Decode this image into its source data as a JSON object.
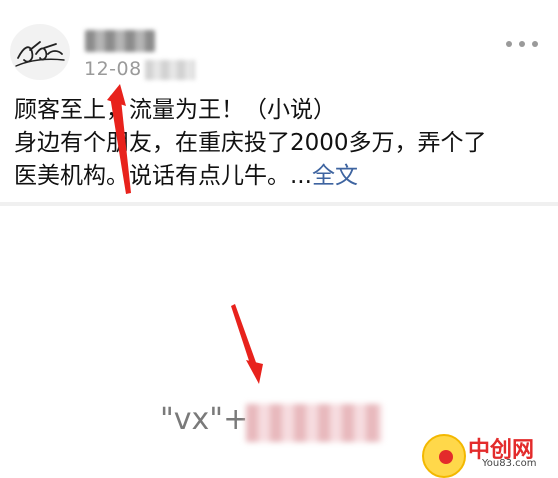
{
  "post": {
    "date": "12-08",
    "lines": [
      "顾客至上，流量为王！（小说）",
      "身边有个朋友，在重庆投了2000多万，弄个了",
      "医美机构。说话有点儿牛。..."
    ],
    "expand_label": "全文"
  },
  "image_content": {
    "contact_prefix": "\"vx\"+"
  },
  "watermark": {
    "name": "中创网",
    "url": "You83.com"
  },
  "colors": {
    "link": "#3e64a0",
    "arrow": "#e8221c",
    "meta_text": "#9a9a9a"
  },
  "icons": {
    "more": "more-dots-icon",
    "arrow": "red-arrow-annotation"
  }
}
